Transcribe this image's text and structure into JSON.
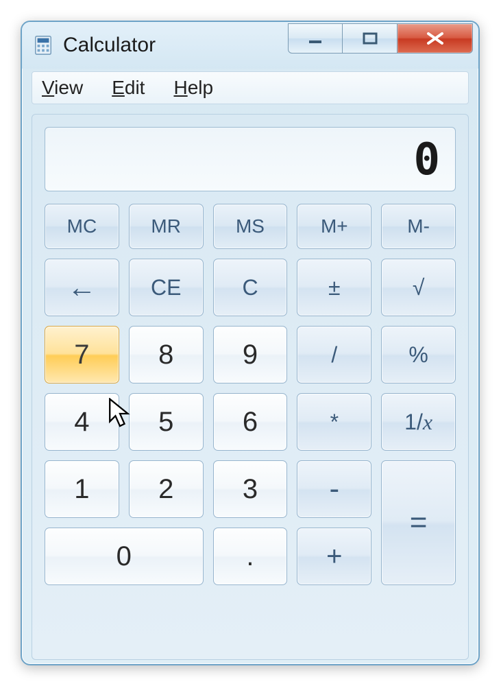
{
  "window": {
    "title": "Calculator"
  },
  "menu": {
    "view": "View",
    "edit": "Edit",
    "help": "Help"
  },
  "display": {
    "value": "0"
  },
  "buttons": {
    "mc": "MC",
    "mr": "MR",
    "ms": "MS",
    "mplus": "M+",
    "mminus": "M-",
    "back": "←",
    "ce": "CE",
    "c": "C",
    "neg": "±",
    "sqrt": "√",
    "7": "7",
    "8": "8",
    "9": "9",
    "div": "/",
    "pct": "%",
    "4": "4",
    "5": "5",
    "6": "6",
    "mul": "*",
    "recip": "1/x",
    "1": "1",
    "2": "2",
    "3": "3",
    "sub": "-",
    "eq": "=",
    "0": "0",
    "dot": ".",
    "add": "+"
  }
}
